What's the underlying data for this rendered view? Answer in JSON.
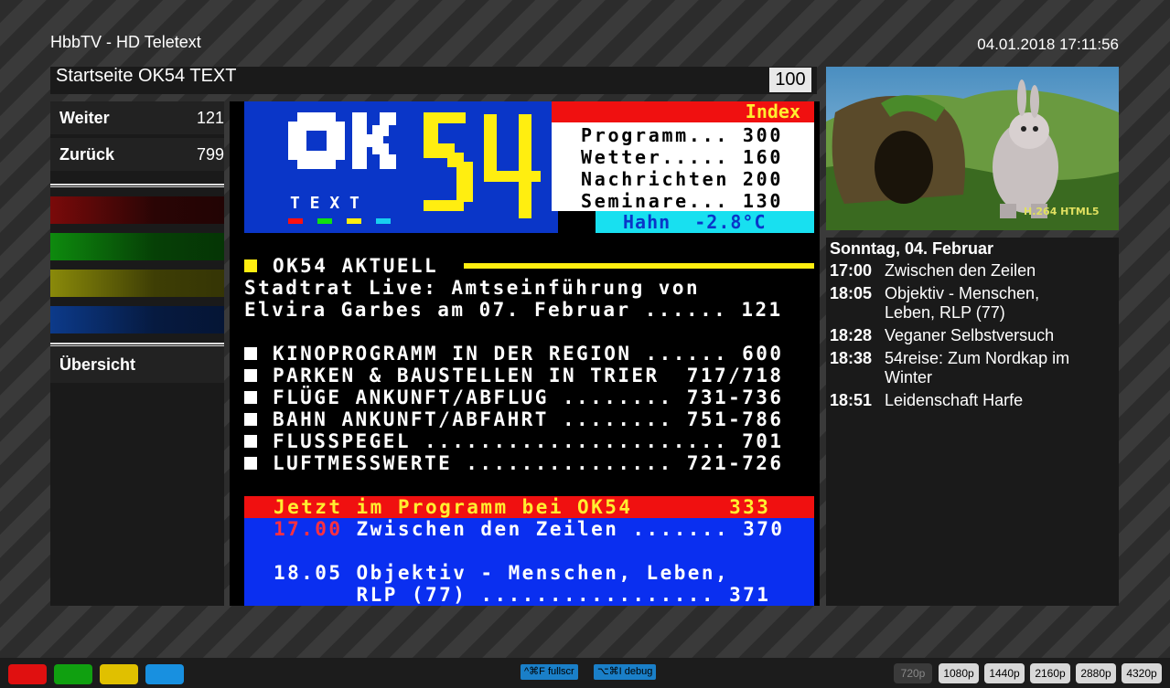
{
  "app": {
    "title": "HbbTV - HD Teletext",
    "clock": "04.01.2018 17:11:56"
  },
  "pagebar": {
    "title": "Startseite OK54 TEXT",
    "page_number": "100"
  },
  "nav": {
    "weiter": {
      "label": "Weiter",
      "page": "121"
    },
    "zurueck": {
      "label": "Zurück",
      "page": "799"
    },
    "uebersicht": "Übersicht"
  },
  "colors": {
    "red": "#e01010",
    "green": "#10a010",
    "yellow": "#e0c000",
    "blue": "#1890e0"
  },
  "teletext": {
    "logo_text": "T E X T",
    "index": {
      "header": "Index",
      "rows": [
        "Programm... 300",
        "Wetter..... 160",
        "Nachrichten 200",
        "Seminare... 130"
      ]
    },
    "weather": "Hahn  -2.8°C",
    "aktuell": {
      "heading": "OK54 AKTUELL",
      "line1": "Stadtrat Live: Amtseinführung von",
      "line2": "Elvira Garbes am 07. Februar ...... 121"
    },
    "links": [
      "KINOPROGRAMM IN DER REGION ...... 600",
      "PARKEN & BAUSTELLEN IN TRIER  717/718",
      "FLÜGE ANKUNFT/ABFLUG ........ 731-736",
      "BAHN ANKUNFT/ABFAHRT ........ 751-786",
      "FLUSSPEGEL ...................... 701",
      "LUFTMESSWERTE ............... 721-726"
    ],
    "program": {
      "header": "Jetzt im Programm bei OK54       333",
      "row1_time": "17.00",
      "row1_text": " Zwischen den Zeilen ....... 370",
      "row2": "18.05 Objektiv - Menschen, Leben,",
      "row3": "      RLP (77) ................. 371"
    }
  },
  "video": {
    "watermark": "H.264 HTML5"
  },
  "epg": {
    "date": "Sonntag, 04. Februar",
    "items": [
      {
        "time": "17:00",
        "title": "Zwischen den Zeilen"
      },
      {
        "time": "18:05",
        "title": "Objektiv - Menschen, Leben, RLP (77)"
      },
      {
        "time": "18:28",
        "title": "Veganer Selbstversuch"
      },
      {
        "time": "18:38",
        "title": "54reise: Zum Nordkap im Winter"
      },
      {
        "time": "18:51",
        "title": "Leidenschaft Harfe"
      }
    ]
  },
  "bottom": {
    "fullscreen_key": "^⌘F",
    "fullscreen_label": "fullscr",
    "debug_key": "⌥⌘I",
    "debug_label": "debug",
    "resolutions": [
      "720p",
      "1080p",
      "1440p",
      "2160p",
      "2880p",
      "4320p"
    ]
  }
}
